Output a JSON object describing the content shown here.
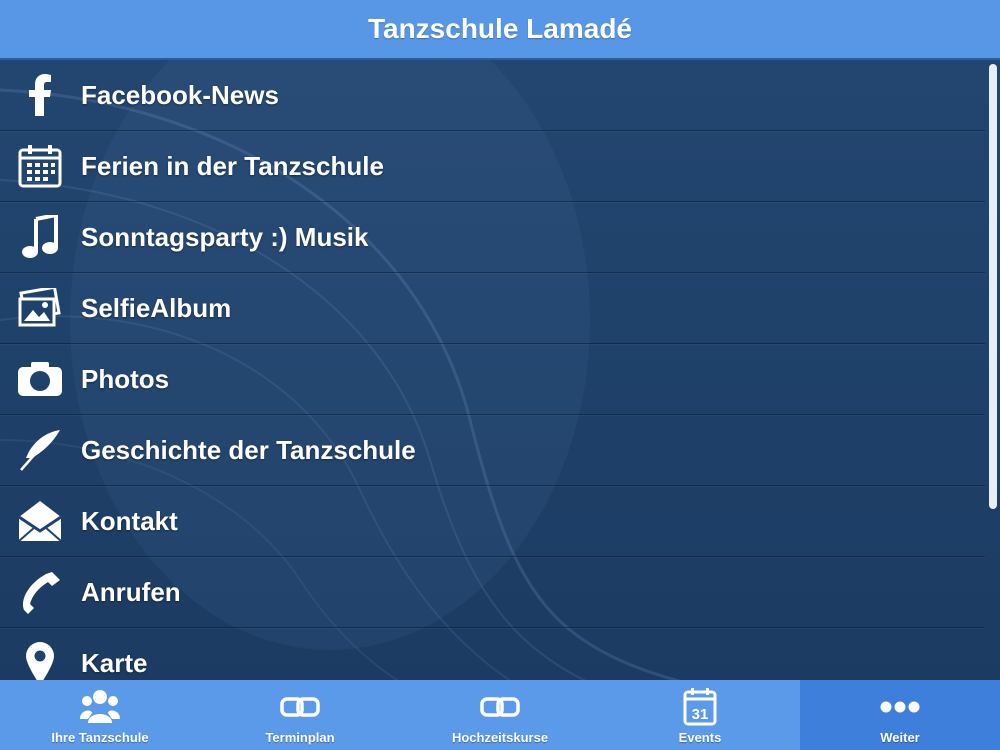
{
  "header": {
    "title": "Tanzschule Lamadé"
  },
  "menu": {
    "items": [
      {
        "label": "Facebook-News",
        "icon": "facebook-icon"
      },
      {
        "label": "Ferien in der Tanzschule",
        "icon": "calendar-icon"
      },
      {
        "label": "Sonntagsparty :) Musik",
        "icon": "music-note-icon"
      },
      {
        "label": "SelfieAlbum",
        "icon": "photo-album-icon"
      },
      {
        "label": "Photos",
        "icon": "camera-icon"
      },
      {
        "label": "Geschichte der Tanzschule",
        "icon": "feather-icon"
      },
      {
        "label": "Kontakt",
        "icon": "envelope-icon"
      },
      {
        "label": "Anrufen",
        "icon": "phone-icon"
      },
      {
        "label": "Karte",
        "icon": "map-pin-icon"
      }
    ]
  },
  "tabbar": {
    "tabs": [
      {
        "label": "Ihre Tanzschule",
        "icon": "people-icon",
        "active": false
      },
      {
        "label": "Terminplan",
        "icon": "link-icon",
        "active": false
      },
      {
        "label": "Hochzeitskurse",
        "icon": "link-icon",
        "active": false
      },
      {
        "label": "Events",
        "icon": "calendar-31-icon",
        "date_number": "31",
        "active": false
      },
      {
        "label": "Weiter",
        "icon": "more-dots-icon",
        "active": true
      }
    ]
  },
  "colors": {
    "header_bg": "#5797e6",
    "content_bg": "#1f426b",
    "tabbar_bg": "#5a9ae8",
    "tab_active_bg": "#3f7fdc",
    "text": "#ffffff"
  }
}
